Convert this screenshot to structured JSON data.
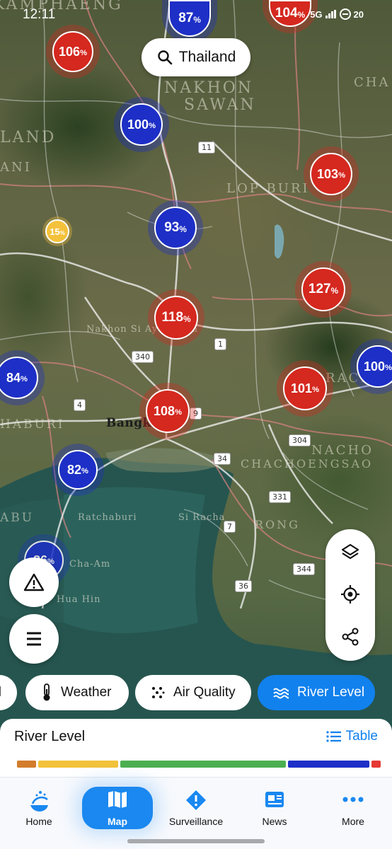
{
  "status_bar": {
    "time": "12:11",
    "network": "5G",
    "battery": "20"
  },
  "search": {
    "label": "Thailand",
    "icon": "search-icon"
  },
  "map": {
    "place_labels": [
      "KAMPHAENG",
      "NAKHON",
      "SAWAN",
      "LOP BURI",
      "Nakhon Si Ayutthaya",
      "Bangkok",
      "Si Racha",
      "Hua Hin",
      "Cha-Am",
      "CHA",
      "NACHO",
      "RACHA",
      "CHACHOENGSAO",
      "RONG",
      "Ratchaburi",
      "HABURI",
      "ABU",
      "LAND",
      "ANI"
    ],
    "road_numbers": [
      "11",
      "1",
      "340",
      "4",
      "9",
      "34",
      "304",
      "331",
      "7",
      "344",
      "36"
    ],
    "markers": [
      {
        "value": "87",
        "unit": "%",
        "color": "blue"
      },
      {
        "value": "104",
        "unit": "%",
        "color": "red"
      },
      {
        "value": "106",
        "unit": "%",
        "color": "red"
      },
      {
        "value": "100",
        "unit": "%",
        "color": "blue"
      },
      {
        "value": "103",
        "unit": "%",
        "color": "red"
      },
      {
        "value": "15",
        "unit": "%",
        "color": "yellow"
      },
      {
        "value": "93",
        "unit": "%",
        "color": "blue"
      },
      {
        "value": "127",
        "unit": "%",
        "color": "red"
      },
      {
        "value": "118",
        "unit": "%",
        "color": "red"
      },
      {
        "value": "100",
        "unit": "%",
        "color": "blue"
      },
      {
        "value": "84",
        "unit": "%",
        "color": "blue"
      },
      {
        "value": "101",
        "unit": "%",
        "color": "red"
      },
      {
        "value": "108",
        "unit": "%",
        "color": "red"
      },
      {
        "value": "82",
        "unit": "%",
        "color": "blue"
      },
      {
        "value": "86",
        "unit": "%",
        "color": "blue"
      }
    ]
  },
  "controls": {
    "layers": "layers-icon",
    "locate": "locate-icon",
    "share": "share-icon",
    "warning": "warning-icon",
    "menu": "menu-icon"
  },
  "layer_chips": [
    {
      "label": "l",
      "icon": "",
      "active": false
    },
    {
      "label": "Weather",
      "icon": "thermometer-icon",
      "active": false
    },
    {
      "label": "Air Quality",
      "icon": "dots-icon",
      "active": false
    },
    {
      "label": "River Level",
      "icon": "waves-icon",
      "active": true
    }
  ],
  "legend": {
    "title": "River Level",
    "table_label": "Table",
    "colors": [
      "#d27c2c",
      "#f2c23a",
      "#4caf50",
      "#1d2fc6",
      "#e53935"
    ]
  },
  "nav": {
    "items": [
      {
        "label": "Home",
        "icon": "home-icon",
        "active": false
      },
      {
        "label": "Map",
        "icon": "map-icon",
        "active": true
      },
      {
        "label": "Surveillance",
        "icon": "alert-diamond-icon",
        "active": false
      },
      {
        "label": "News",
        "icon": "news-icon",
        "active": false
      },
      {
        "label": "More",
        "icon": "more-icon",
        "active": false
      }
    ]
  },
  "colors": {
    "accent": "#1181ee",
    "red_marker": "#d5281f",
    "blue_marker": "#1d2fc6",
    "yellow_marker": "#f4c13b"
  }
}
